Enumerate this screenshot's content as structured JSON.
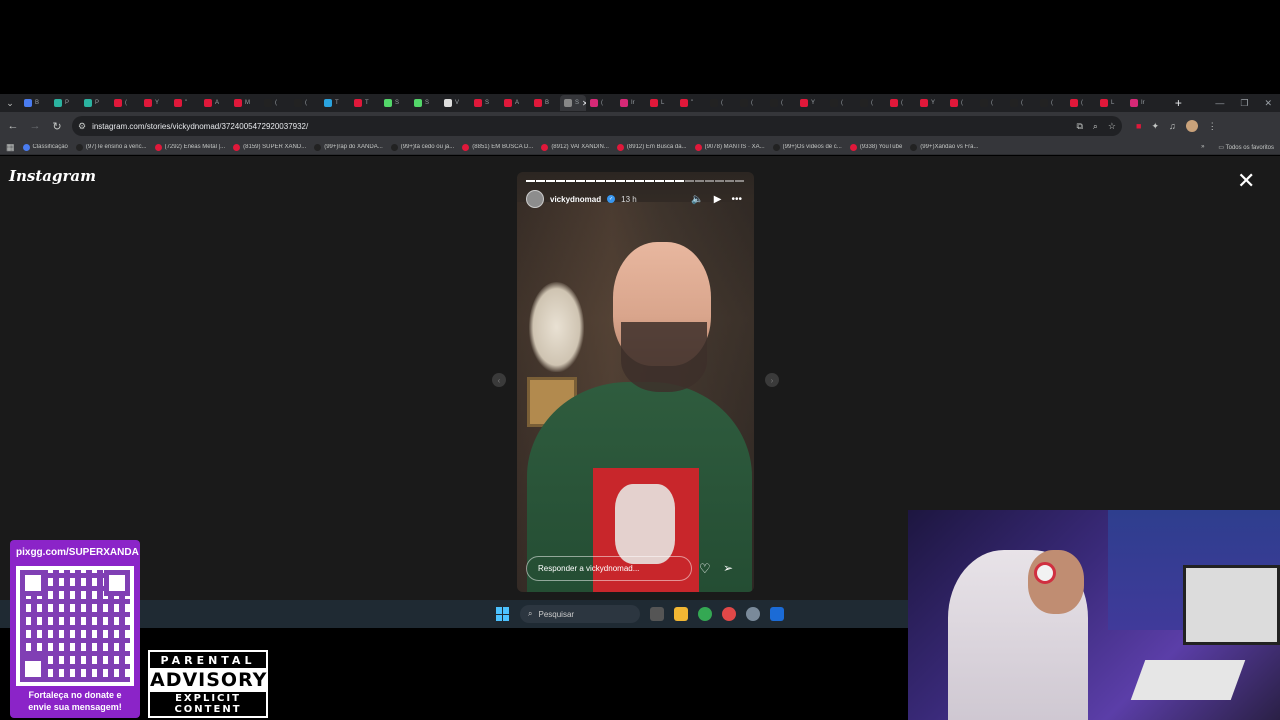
{
  "browser": {
    "tabs": [
      {
        "label": "B",
        "color": "#4a7cf0"
      },
      {
        "label": "P",
        "color": "#2bb3a0"
      },
      {
        "label": "P",
        "color": "#2bb3a0"
      },
      {
        "label": "(",
        "color": "#e0183a"
      },
      {
        "label": "Y",
        "color": "#e0183a"
      },
      {
        "label": "\"",
        "color": "#e0183a"
      },
      {
        "label": "A",
        "color": "#e0183a"
      },
      {
        "label": "M",
        "color": "#e0183a"
      },
      {
        "label": "(",
        "color": "#222222"
      },
      {
        "label": "(",
        "color": "#222222"
      },
      {
        "label": "T",
        "color": "#2aa3df"
      },
      {
        "label": "T",
        "color": "#e0183a"
      },
      {
        "label": "S",
        "color": "#53d769"
      },
      {
        "label": "S",
        "color": "#53d769"
      },
      {
        "label": "V",
        "color": "#dddddd"
      },
      {
        "label": "S",
        "color": "#e0183a"
      },
      {
        "label": "A",
        "color": "#e0183a"
      },
      {
        "label": "B",
        "color": "#e0183a"
      },
      {
        "label": "S",
        "color": "#888888",
        "active": true
      },
      {
        "label": "(",
        "color": "#d62976"
      },
      {
        "label": "Ir",
        "color": "#d62976"
      },
      {
        "label": "L",
        "color": "#e0183a"
      },
      {
        "label": "\"",
        "color": "#e0183a"
      },
      {
        "label": "(",
        "color": "#222222"
      },
      {
        "label": "(",
        "color": "#222222"
      },
      {
        "label": "(",
        "color": "#222222"
      },
      {
        "label": "Y",
        "color": "#e0183a"
      },
      {
        "label": "(",
        "color": "#222222"
      },
      {
        "label": "(",
        "color": "#222222"
      },
      {
        "label": "(",
        "color": "#e0183a"
      },
      {
        "label": "Y",
        "color": "#e0183a"
      },
      {
        "label": "(",
        "color": "#e0183a"
      },
      {
        "label": "(",
        "color": "#222222"
      },
      {
        "label": "(",
        "color": "#222222"
      },
      {
        "label": "(",
        "color": "#222222"
      },
      {
        "label": "(",
        "color": "#e0183a"
      },
      {
        "label": "L",
        "color": "#e0183a"
      },
      {
        "label": "Ir",
        "color": "#d62976"
      }
    ],
    "url": "instagram.com/stories/vickydnomad/3724005472920037932/",
    "bookmarks": [
      {
        "label": "Classificação",
        "color": "#4a7cf0"
      },
      {
        "label": "(97)Te ensino a venc...",
        "color": "#222222"
      },
      {
        "label": "(7292) Enéas Metal |...",
        "color": "#e0183a"
      },
      {
        "label": "(8159) SUPER XAND...",
        "color": "#e0183a"
      },
      {
        "label": "(99+)rap do XANDÃ...",
        "color": "#222222"
      },
      {
        "label": "(99+)tá cedo ou já...",
        "color": "#222222"
      },
      {
        "label": "(8851) EM BUSCA D...",
        "color": "#e0183a"
      },
      {
        "label": "(8912) VAI XANDIN...",
        "color": "#e0183a"
      },
      {
        "label": "(8912) Em Busca da...",
        "color": "#e0183a"
      },
      {
        "label": "(9078) MANTIS · XA...",
        "color": "#e0183a"
      },
      {
        "label": "(99+)Os vídeos de c...",
        "color": "#222222"
      },
      {
        "label": "(9338) YouTube",
        "color": "#e0183a"
      },
      {
        "label": "(99+)Xandão vs Fra...",
        "color": "#222222"
      }
    ],
    "all_bookmarks": "Todos os favoritos"
  },
  "instagram": {
    "logo": "Instagram",
    "story": {
      "username": "vickydnomad",
      "time": "13 h",
      "reply_placeholder": "Responder a vickydnomad...",
      "progress_total": 22,
      "progress_done": 16
    }
  },
  "taskbar": {
    "search_placeholder": "Pesquisar"
  },
  "overlay": {
    "pix_url": "pixgg.com/SUPERXANDA",
    "pix_line1": "Fortaleça no donate e",
    "pix_line2": "envie sua mensagem!",
    "advisory_top": "PARENTAL",
    "advisory_mid": "ADVISORY",
    "advisory_bot": "EXPLICIT CONTENT"
  }
}
